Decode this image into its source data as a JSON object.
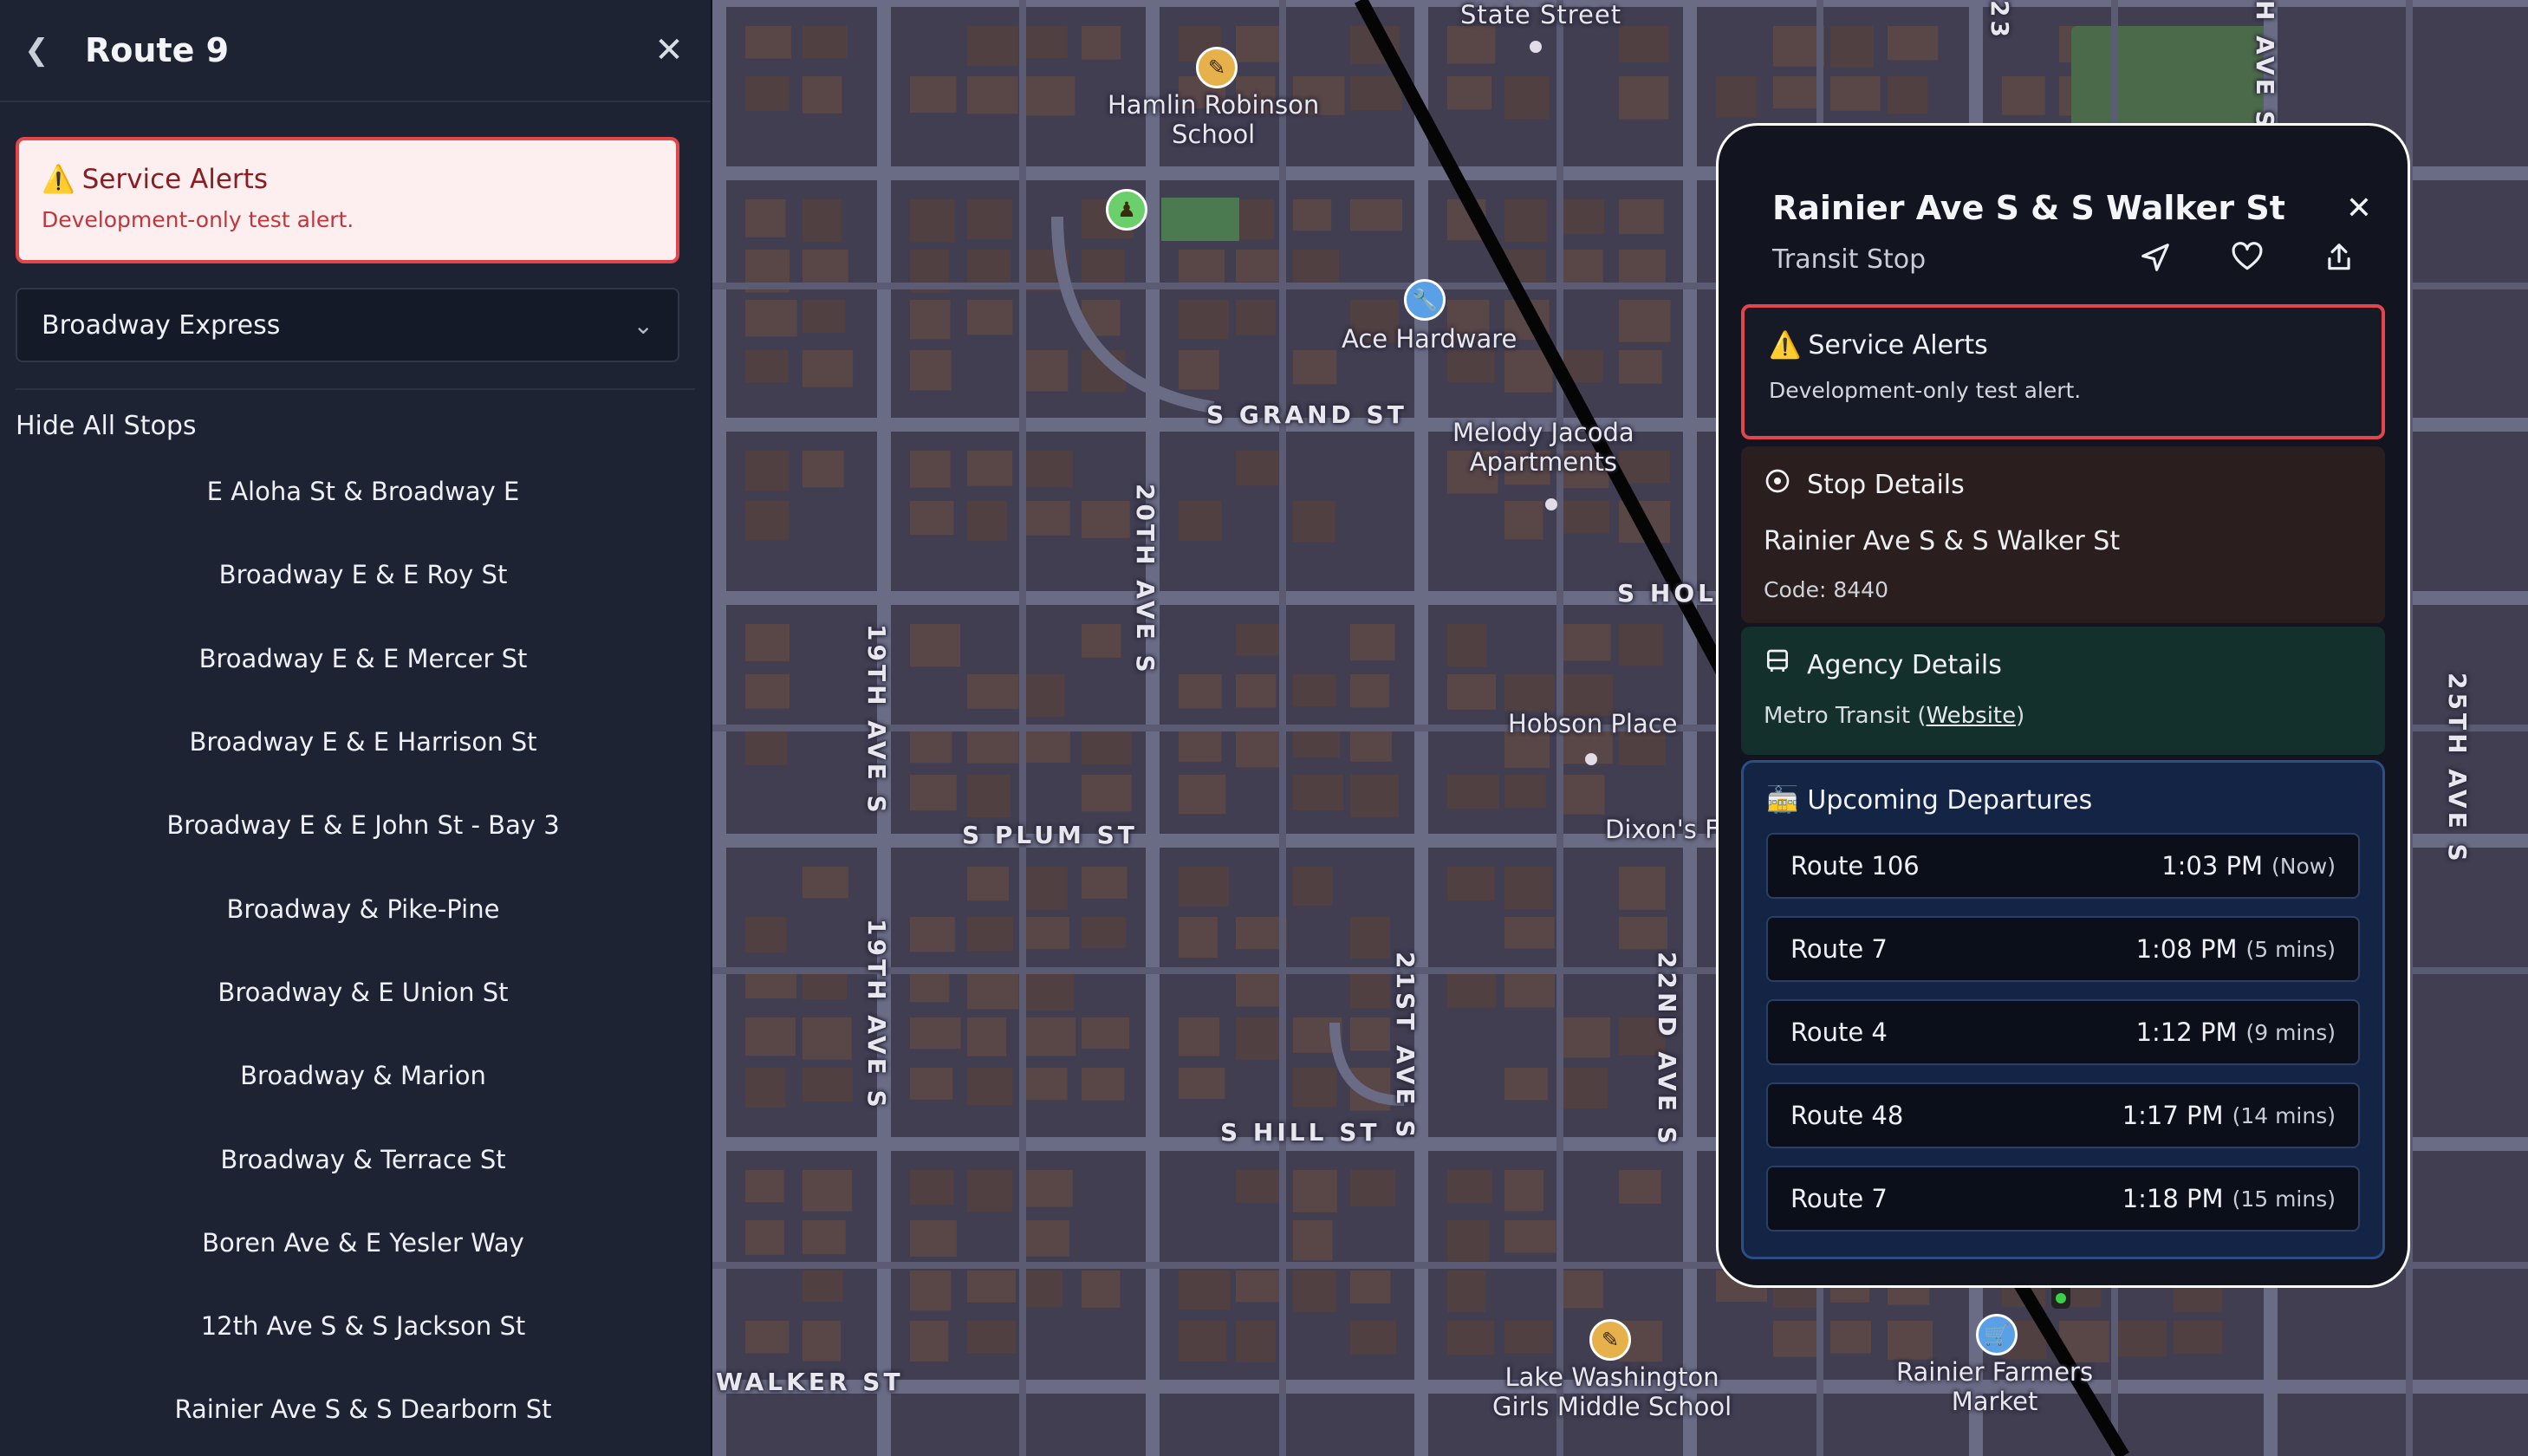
{
  "sidebar": {
    "back_icon": "chevron-left-icon",
    "title": "Route 9",
    "close_icon": "close-icon",
    "alert": {
      "icon": "warning-icon",
      "title": "Service Alerts",
      "message": "Development-only test alert."
    },
    "route_select": {
      "value": "Broadway Express"
    },
    "hide_stops_label": "Hide All Stops",
    "stops": [
      "E Aloha St & Broadway E",
      "Broadway E & E Roy St",
      "Broadway E & E Mercer St",
      "Broadway E & E Harrison St",
      "Broadway E & E John St - Bay 3",
      "Broadway & Pike-Pine",
      "Broadway & E Union St",
      "Broadway & Marion",
      "Broadway & Terrace St",
      "Boren Ave & E Yesler Way",
      "12th Ave S & S Jackson St",
      "Rainier Ave S & S Dearborn St"
    ]
  },
  "popup": {
    "title": "Rainier Ave S & S Walker St",
    "subtitle": "Transit Stop",
    "actions": [
      "directions-icon",
      "heart-icon",
      "share-icon"
    ],
    "alert": {
      "icon": "warning-icon",
      "title": "Service Alerts",
      "message": "Development-only test alert."
    },
    "stop_details": {
      "icon": "info-circle-icon",
      "title": "Stop Details",
      "name": "Rainier Ave S & S Walker St",
      "code": "Code: 8440"
    },
    "agency_details": {
      "icon": "bus-icon",
      "title": "Agency Details",
      "agency": "Metro Transit",
      "link_open": "(",
      "link_text": "Website",
      "link_close": ")"
    },
    "departures": {
      "icon": "tram-icon",
      "title": "Upcoming Departures",
      "items": [
        {
          "route": "Route 106",
          "time": "1:03 PM",
          "relative": "(Now)"
        },
        {
          "route": "Route 7",
          "time": "1:08 PM",
          "relative": "(5 mins)"
        },
        {
          "route": "Route 4",
          "time": "1:12 PM",
          "relative": "(9 mins)"
        },
        {
          "route": "Route 48",
          "time": "1:17 PM",
          "relative": "(14 mins)"
        },
        {
          "route": "Route 7",
          "time": "1:18 PM",
          "relative": "(15 mins)"
        }
      ]
    }
  },
  "map": {
    "streets": {
      "state": "State Street",
      "grand": "S GRAND ST",
      "plum": "S PLUM ST",
      "hill": "S HILL ST",
      "walker": "WALKER ST",
      "holgate": "S HOL",
      "ave20": "20TH AVE S",
      "ave19a": "19TH AVE S",
      "ave19b": "19TH AVE S",
      "ave21": "21ST AVE S",
      "ave22": "22ND AVE S",
      "ave25": "25TH AVE S",
      "ave23": "23",
      "aveH": "H AVE S"
    },
    "pois": {
      "hamlin": "Hamlin Robinson\nSchool",
      "ace": "Ace Hardware",
      "melody": "Melody Jacoda\nApartments",
      "hobson": "Hobson Place",
      "dixon": "Dixon's F",
      "lakewash": "Lake Washington\nGirls Middle School",
      "rainier_market": "Rainier Farmers\nMarket"
    },
    "colors": {
      "background": "#413e52",
      "road": "#6a6c86",
      "block": "#5b4646",
      "rail": "#050505"
    }
  }
}
